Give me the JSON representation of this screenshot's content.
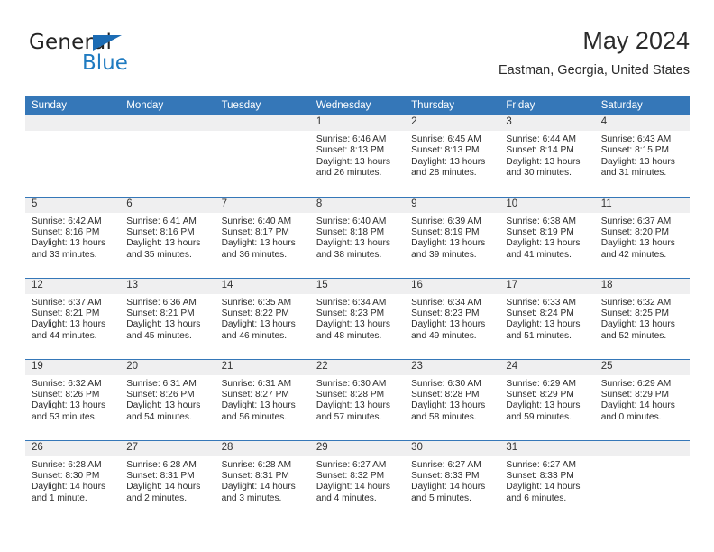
{
  "logo": {
    "word_top": "General",
    "word_bottom": "Blue",
    "triangle_color": "#1c6cb4",
    "blue_text_color": "#1f7bc1"
  },
  "header": {
    "month_title": "May 2024",
    "location": "Eastman, Georgia, United States"
  },
  "theme": {
    "header_bg": "#3577b8",
    "daynum_band_bg": "#efeff0",
    "row_divider": "#3577b8"
  },
  "weekday_headers": [
    "Sunday",
    "Monday",
    "Tuesday",
    "Wednesday",
    "Thursday",
    "Friday",
    "Saturday"
  ],
  "weeks": [
    [
      {
        "day": "",
        "empty": true
      },
      {
        "day": "",
        "empty": true
      },
      {
        "day": "",
        "empty": true
      },
      {
        "day": "1",
        "sunrise": "Sunrise: 6:46 AM",
        "sunset": "Sunset: 8:13 PM",
        "daylight_1": "Daylight: 13 hours",
        "daylight_2": "and 26 minutes."
      },
      {
        "day": "2",
        "sunrise": "Sunrise: 6:45 AM",
        "sunset": "Sunset: 8:13 PM",
        "daylight_1": "Daylight: 13 hours",
        "daylight_2": "and 28 minutes."
      },
      {
        "day": "3",
        "sunrise": "Sunrise: 6:44 AM",
        "sunset": "Sunset: 8:14 PM",
        "daylight_1": "Daylight: 13 hours",
        "daylight_2": "and 30 minutes."
      },
      {
        "day": "4",
        "sunrise": "Sunrise: 6:43 AM",
        "sunset": "Sunset: 8:15 PM",
        "daylight_1": "Daylight: 13 hours",
        "daylight_2": "and 31 minutes."
      }
    ],
    [
      {
        "day": "5",
        "sunrise": "Sunrise: 6:42 AM",
        "sunset": "Sunset: 8:16 PM",
        "daylight_1": "Daylight: 13 hours",
        "daylight_2": "and 33 minutes."
      },
      {
        "day": "6",
        "sunrise": "Sunrise: 6:41 AM",
        "sunset": "Sunset: 8:16 PM",
        "daylight_1": "Daylight: 13 hours",
        "daylight_2": "and 35 minutes."
      },
      {
        "day": "7",
        "sunrise": "Sunrise: 6:40 AM",
        "sunset": "Sunset: 8:17 PM",
        "daylight_1": "Daylight: 13 hours",
        "daylight_2": "and 36 minutes."
      },
      {
        "day": "8",
        "sunrise": "Sunrise: 6:40 AM",
        "sunset": "Sunset: 8:18 PM",
        "daylight_1": "Daylight: 13 hours",
        "daylight_2": "and 38 minutes."
      },
      {
        "day": "9",
        "sunrise": "Sunrise: 6:39 AM",
        "sunset": "Sunset: 8:19 PM",
        "daylight_1": "Daylight: 13 hours",
        "daylight_2": "and 39 minutes."
      },
      {
        "day": "10",
        "sunrise": "Sunrise: 6:38 AM",
        "sunset": "Sunset: 8:19 PM",
        "daylight_1": "Daylight: 13 hours",
        "daylight_2": "and 41 minutes."
      },
      {
        "day": "11",
        "sunrise": "Sunrise: 6:37 AM",
        "sunset": "Sunset: 8:20 PM",
        "daylight_1": "Daylight: 13 hours",
        "daylight_2": "and 42 minutes."
      }
    ],
    [
      {
        "day": "12",
        "sunrise": "Sunrise: 6:37 AM",
        "sunset": "Sunset: 8:21 PM",
        "daylight_1": "Daylight: 13 hours",
        "daylight_2": "and 44 minutes."
      },
      {
        "day": "13",
        "sunrise": "Sunrise: 6:36 AM",
        "sunset": "Sunset: 8:21 PM",
        "daylight_1": "Daylight: 13 hours",
        "daylight_2": "and 45 minutes."
      },
      {
        "day": "14",
        "sunrise": "Sunrise: 6:35 AM",
        "sunset": "Sunset: 8:22 PM",
        "daylight_1": "Daylight: 13 hours",
        "daylight_2": "and 46 minutes."
      },
      {
        "day": "15",
        "sunrise": "Sunrise: 6:34 AM",
        "sunset": "Sunset: 8:23 PM",
        "daylight_1": "Daylight: 13 hours",
        "daylight_2": "and 48 minutes."
      },
      {
        "day": "16",
        "sunrise": "Sunrise: 6:34 AM",
        "sunset": "Sunset: 8:23 PM",
        "daylight_1": "Daylight: 13 hours",
        "daylight_2": "and 49 minutes."
      },
      {
        "day": "17",
        "sunrise": "Sunrise: 6:33 AM",
        "sunset": "Sunset: 8:24 PM",
        "daylight_1": "Daylight: 13 hours",
        "daylight_2": "and 51 minutes."
      },
      {
        "day": "18",
        "sunrise": "Sunrise: 6:32 AM",
        "sunset": "Sunset: 8:25 PM",
        "daylight_1": "Daylight: 13 hours",
        "daylight_2": "and 52 minutes."
      }
    ],
    [
      {
        "day": "19",
        "sunrise": "Sunrise: 6:32 AM",
        "sunset": "Sunset: 8:26 PM",
        "daylight_1": "Daylight: 13 hours",
        "daylight_2": "and 53 minutes."
      },
      {
        "day": "20",
        "sunrise": "Sunrise: 6:31 AM",
        "sunset": "Sunset: 8:26 PM",
        "daylight_1": "Daylight: 13 hours",
        "daylight_2": "and 54 minutes."
      },
      {
        "day": "21",
        "sunrise": "Sunrise: 6:31 AM",
        "sunset": "Sunset: 8:27 PM",
        "daylight_1": "Daylight: 13 hours",
        "daylight_2": "and 56 minutes."
      },
      {
        "day": "22",
        "sunrise": "Sunrise: 6:30 AM",
        "sunset": "Sunset: 8:28 PM",
        "daylight_1": "Daylight: 13 hours",
        "daylight_2": "and 57 minutes."
      },
      {
        "day": "23",
        "sunrise": "Sunrise: 6:30 AM",
        "sunset": "Sunset: 8:28 PM",
        "daylight_1": "Daylight: 13 hours",
        "daylight_2": "and 58 minutes."
      },
      {
        "day": "24",
        "sunrise": "Sunrise: 6:29 AM",
        "sunset": "Sunset: 8:29 PM",
        "daylight_1": "Daylight: 13 hours",
        "daylight_2": "and 59 minutes."
      },
      {
        "day": "25",
        "sunrise": "Sunrise: 6:29 AM",
        "sunset": "Sunset: 8:29 PM",
        "daylight_1": "Daylight: 14 hours",
        "daylight_2": "and 0 minutes."
      }
    ],
    [
      {
        "day": "26",
        "sunrise": "Sunrise: 6:28 AM",
        "sunset": "Sunset: 8:30 PM",
        "daylight_1": "Daylight: 14 hours",
        "daylight_2": "and 1 minute."
      },
      {
        "day": "27",
        "sunrise": "Sunrise: 6:28 AM",
        "sunset": "Sunset: 8:31 PM",
        "daylight_1": "Daylight: 14 hours",
        "daylight_2": "and 2 minutes."
      },
      {
        "day": "28",
        "sunrise": "Sunrise: 6:28 AM",
        "sunset": "Sunset: 8:31 PM",
        "daylight_1": "Daylight: 14 hours",
        "daylight_2": "and 3 minutes."
      },
      {
        "day": "29",
        "sunrise": "Sunrise: 6:27 AM",
        "sunset": "Sunset: 8:32 PM",
        "daylight_1": "Daylight: 14 hours",
        "daylight_2": "and 4 minutes."
      },
      {
        "day": "30",
        "sunrise": "Sunrise: 6:27 AM",
        "sunset": "Sunset: 8:33 PM",
        "daylight_1": "Daylight: 14 hours",
        "daylight_2": "and 5 minutes."
      },
      {
        "day": "31",
        "sunrise": "Sunrise: 6:27 AM",
        "sunset": "Sunset: 8:33 PM",
        "daylight_1": "Daylight: 14 hours",
        "daylight_2": "and 6 minutes."
      },
      {
        "day": "",
        "empty": true
      }
    ]
  ]
}
